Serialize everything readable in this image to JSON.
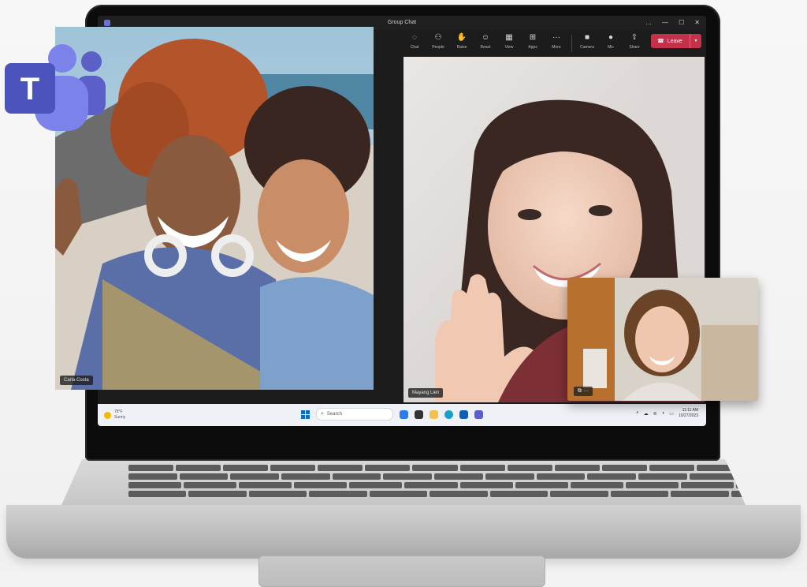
{
  "window": {
    "title": "Group Chat",
    "controls": [
      "…",
      "—",
      "☐",
      "✕"
    ]
  },
  "toolbar": {
    "items": [
      {
        "icon": "chat-icon",
        "glyph": "◌",
        "label": "Chat"
      },
      {
        "icon": "people-icon",
        "glyph": "⚇",
        "label": "People"
      },
      {
        "icon": "raise-hand-icon",
        "glyph": "✋",
        "label": "Raise"
      },
      {
        "icon": "react-icon",
        "glyph": "☺",
        "label": "React"
      },
      {
        "icon": "view-icon",
        "glyph": "▦",
        "label": "View"
      },
      {
        "icon": "apps-icon",
        "glyph": "⊞",
        "label": "Apps"
      },
      {
        "icon": "more-icon",
        "glyph": "···",
        "label": "More"
      }
    ],
    "devices": [
      {
        "icon": "camera-icon",
        "glyph": "■",
        "label": "Camera"
      },
      {
        "icon": "mic-icon",
        "glyph": "●",
        "label": "Mic"
      },
      {
        "icon": "share-icon",
        "glyph": "⇪",
        "label": "Share"
      }
    ],
    "leave": {
      "label": "Leave"
    }
  },
  "participants": {
    "left": {
      "name": "Carla Costa"
    },
    "right": {
      "name": "Mayang Lien"
    }
  },
  "taskbar": {
    "weather": {
      "temp": "78°F",
      "condition": "Sunny"
    },
    "search_label": "Search",
    "clock": {
      "time": "11:11 AM",
      "date": "10/27/2023"
    }
  },
  "colors": {
    "teams_purple": "#5b5fc7",
    "leave_red": "#c4314b",
    "windows_blue": "#0f6cbd"
  }
}
